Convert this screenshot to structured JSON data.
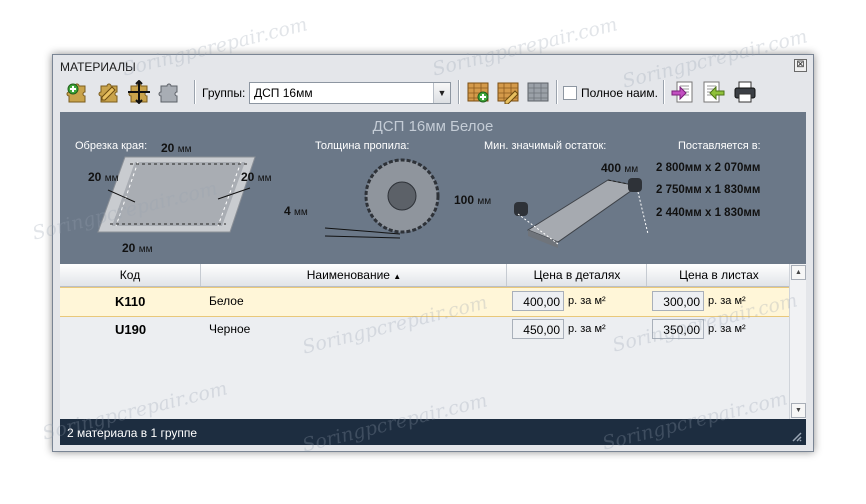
{
  "window": {
    "title": "МАТЕРИАЛЫ",
    "close_glyph": "⊠"
  },
  "toolbar": {
    "groups_label": "Группы:",
    "groups_value": "ДСП 16мм",
    "full_name_label": "Полное наим.",
    "icons": [
      "add-material-icon",
      "edit-material-icon",
      "resize-material-icon",
      "delete-material-icon",
      "add-group-icon",
      "edit-group-icon",
      "delete-group-icon",
      "import-icon",
      "export-icon",
      "print-icon"
    ]
  },
  "info": {
    "title": "ДСП 16мм Белое",
    "edge_trim_label": "Обрезка края:",
    "edge_trim": {
      "top": "20",
      "left": "20",
      "right": "20",
      "bottom": "20",
      "unit": "мм"
    },
    "kerf_label": "Толщина пропила:",
    "kerf": {
      "value": "4",
      "unit": "мм"
    },
    "min_remnant_label": "Мин. значимый остаток:",
    "min_remnant": {
      "length": "400",
      "width": "100",
      "unit": "мм"
    },
    "supplied_label": "Поставляется в:",
    "sizes": [
      "2 800мм x 2 070мм",
      "2 750мм x 1 830мм",
      "2 440мм x 1 830мм"
    ]
  },
  "grid": {
    "headers": {
      "code": "Код",
      "name": "Наименование",
      "sort_glyph": "▲",
      "price_parts": "Цена в деталях",
      "price_sheets": "Цена в листах"
    },
    "rows": [
      {
        "code": "K110",
        "name": "Белое",
        "price_parts": "400,00",
        "price_sheets": "300,00",
        "unit": "р. за м²",
        "selected": true
      },
      {
        "code": "U190",
        "name": "Черное",
        "price_parts": "450,00",
        "price_sheets": "350,00",
        "unit": "р. за м²",
        "selected": false
      }
    ]
  },
  "status": {
    "text": "2 материала в 1 группе"
  },
  "watermark": "Soringpcrepair.com",
  "colors": {
    "info_bg": "#6b7888",
    "status_bg": "#1d2d40",
    "selected_row": "#fff6d8"
  }
}
